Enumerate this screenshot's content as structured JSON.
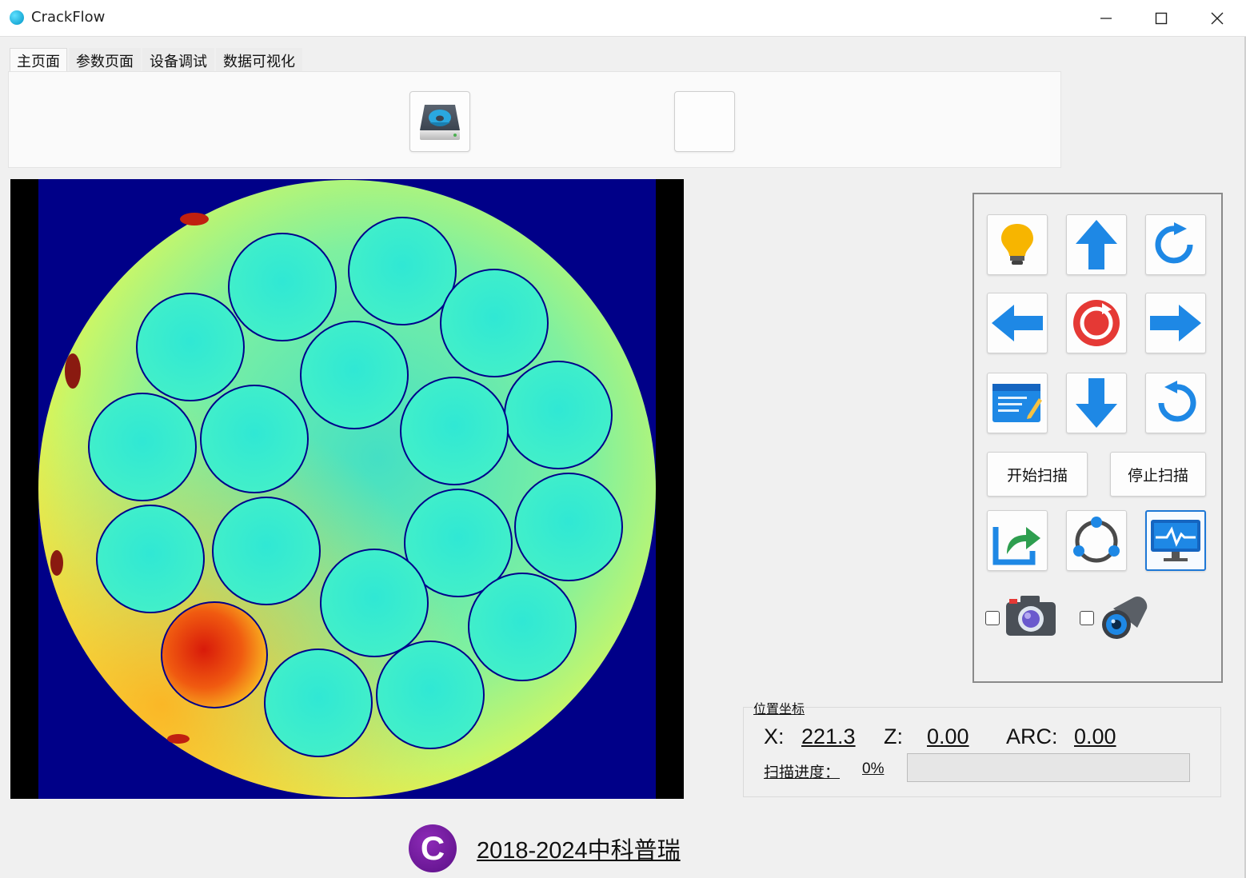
{
  "window": {
    "title": "CrackFlow",
    "controls": [
      "minimize",
      "maximize",
      "close"
    ]
  },
  "tabs": [
    {
      "label": "主页面",
      "active": true
    },
    {
      "label": "参数页面",
      "active": false
    },
    {
      "label": "设备调试",
      "active": false
    },
    {
      "label": "数据可视化",
      "active": false
    }
  ],
  "toolbar": {
    "buttons": [
      {
        "name": "disk-drive-button",
        "icon": "disk-drive-icon"
      },
      {
        "name": "blank-button",
        "icon": ""
      }
    ]
  },
  "controls": {
    "grid_icons": [
      "light-bulb-icon",
      "arrow-up-icon",
      "rotate-clockwise-icon",
      "arrow-left-icon",
      "stop-reset-icon",
      "arrow-right-icon",
      "notes-edit-icon",
      "arrow-down-icon",
      "rotate-counterclockwise-icon"
    ],
    "start_scan_label": "开始扫描",
    "stop_scan_label": "停止扫描",
    "bottom_icons": [
      "export-icon",
      "network-nodes-icon",
      "monitor-waveform-icon"
    ],
    "camera_checkbox_checked": false,
    "scope_checkbox_checked": false
  },
  "position": {
    "legend": "位置坐标",
    "x_label": "X:",
    "x_value": "221.3",
    "z_label": "Z:",
    "z_value": "0.00",
    "arc_label": "ARC:",
    "arc_value": "0.00",
    "progress_label": "扫描进度：",
    "progress_value": "0%",
    "progress_fraction": 0
  },
  "footer": {
    "logo_letter": "C",
    "copyright": "2018-2024中科普瑞"
  },
  "colors": {
    "accent_blue": "#1e88e5",
    "stop_red": "#e53935",
    "heatmap_background": "#000080"
  }
}
